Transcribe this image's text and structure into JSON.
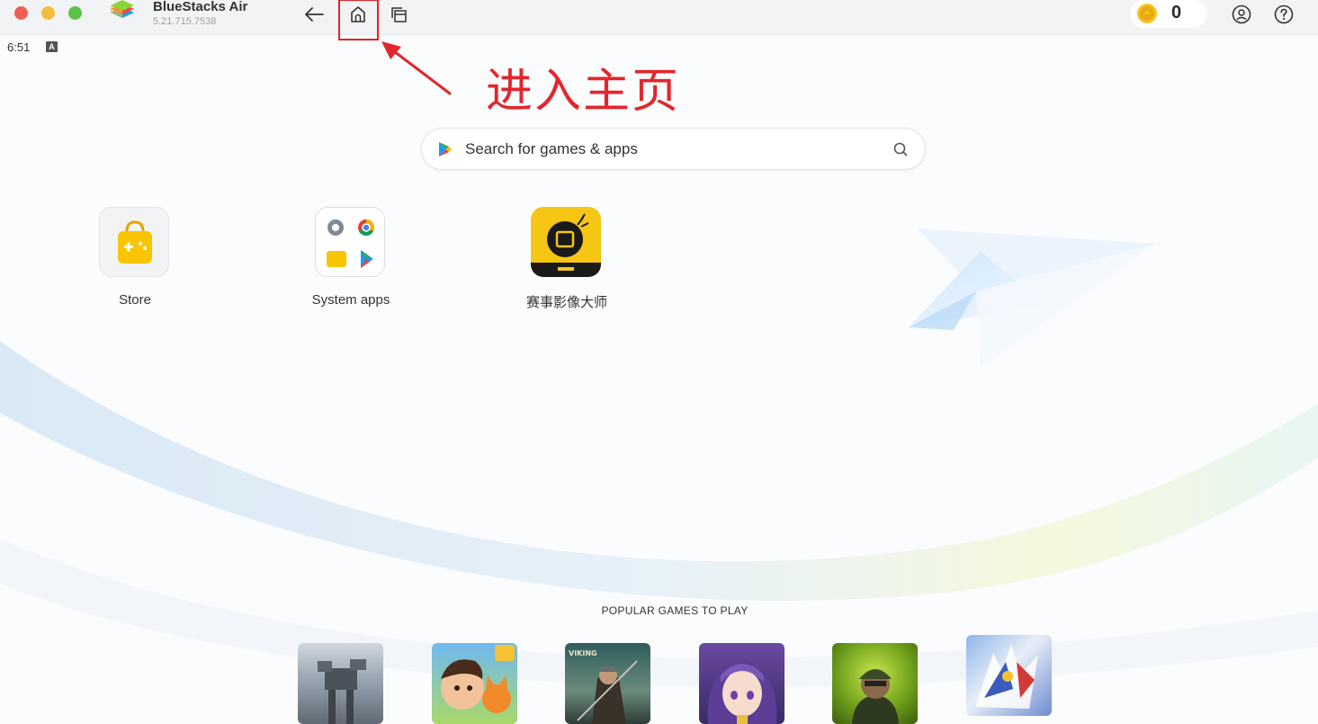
{
  "window": {
    "app_name": "BlueStacks Air",
    "version": "5.21.715.7538",
    "coins": "0"
  },
  "status": {
    "time": "6:51",
    "indicator": "A"
  },
  "annotation": {
    "text": "进入主页",
    "color": "#e3262c"
  },
  "search": {
    "placeholder": "Search for games & apps"
  },
  "apps": [
    {
      "label": "Store",
      "icon": "store-bag-icon"
    },
    {
      "label": "System apps",
      "icon": "system-apps-folder-icon"
    },
    {
      "label": "赛事影像大师",
      "icon": "saishi-app-icon"
    }
  ],
  "popular": {
    "heading": "POPULAR GAMES TO PLAY",
    "games": [
      {
        "icon": "war-robots-game-icon"
      },
      {
        "icon": "cartoon-boy-fox-game-icon"
      },
      {
        "icon": "vikings-game-icon",
        "label": "VIKING"
      },
      {
        "icon": "anime-girl-game-icon"
      },
      {
        "icon": "soldier-game-icon"
      },
      {
        "icon": "mecha-game-icon"
      }
    ]
  },
  "colors": {
    "accent_yellow": "#f8c500",
    "highlight_red": "#e0242a",
    "titlebar": "#f2f3f5"
  }
}
